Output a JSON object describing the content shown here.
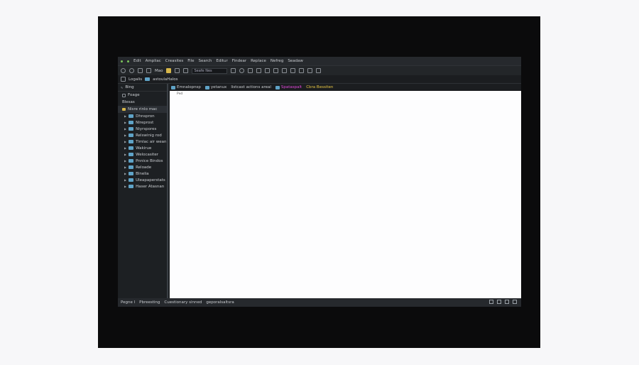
{
  "menu": [
    "Edit",
    "Ampliac",
    "Creasites",
    "File",
    "Search",
    "Editur",
    "Findear",
    "Replace",
    "Nefreg",
    "Seadaw"
  ],
  "toolbar": {
    "run_label": "Mao",
    "search_value": "Seafe Nes"
  },
  "path": {
    "segment1": "Logalis",
    "segment2": "astoulaHalos"
  },
  "sidebar": {
    "header": "Bing",
    "row1": "Foage",
    "row2": "Blesas",
    "folder": "Nisre rinlo mac",
    "items": [
      "Dhnspron",
      "Nlreprost",
      "Niyrspores",
      "Relswinig rod",
      "Timlac air wean",
      "Wakirue",
      "Welocasiter",
      "Pnnice Bindos",
      "Reloade",
      "Blnelia",
      "Uleapaperstats",
      "Haser Atasnan"
    ]
  },
  "tabs": [
    "Emnalopnsp",
    "yetanux",
    "listcast actions areal",
    "Spataspalt",
    "Cbra Bessiten"
  ],
  "editor": {
    "first_line": "Ped"
  },
  "status": {
    "item1": "Pegne l",
    "item2": "Pbreesting",
    "item3": "Cuestionary sinned",
    "item4": "geporalsaltsra"
  }
}
